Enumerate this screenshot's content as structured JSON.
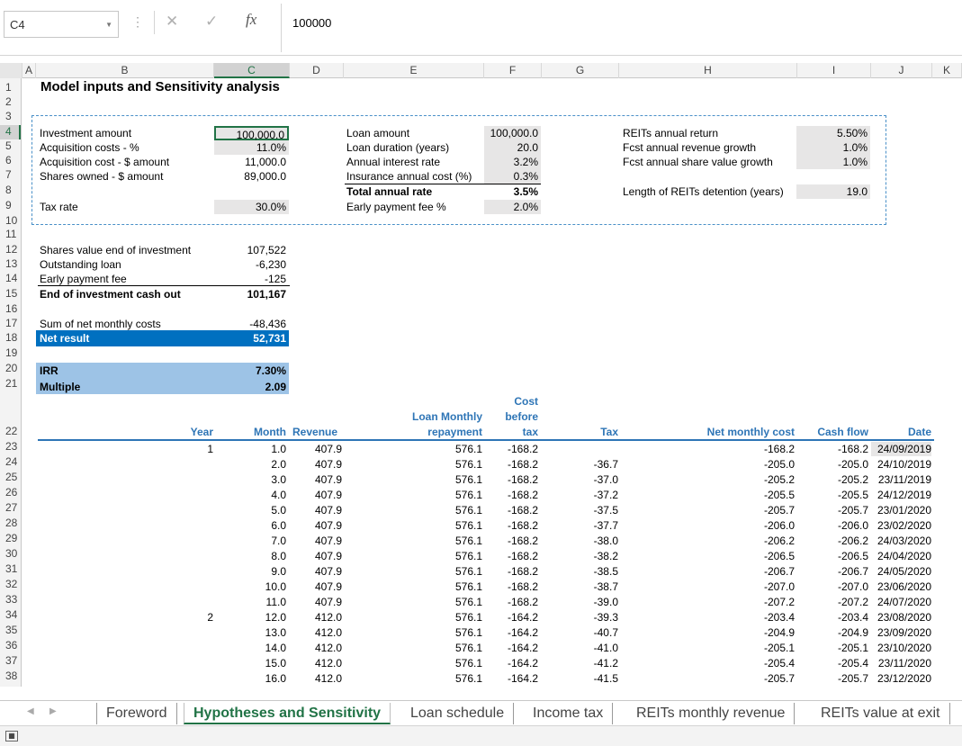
{
  "formula_bar": {
    "name_box": "C4",
    "formula": "100000",
    "fx": "fx"
  },
  "columns": [
    "A",
    "B",
    "C",
    "D",
    "E",
    "F",
    "G",
    "H",
    "I",
    "J",
    "K"
  ],
  "rows": [
    "1",
    "2",
    "3",
    "4",
    "5",
    "6",
    "7",
    "8",
    "9",
    "10",
    "11",
    "12",
    "13",
    "14",
    "15",
    "16",
    "17",
    "18",
    "19",
    "20",
    "21",
    "22",
    "23",
    "24",
    "25",
    "26",
    "27",
    "28",
    "29",
    "30",
    "31",
    "32",
    "33",
    "34",
    "35",
    "36",
    "37",
    "38"
  ],
  "title": "Model inputs and Sensitivity analysis",
  "inputs_left": [
    {
      "label": "Investment amount",
      "value": "100,000.0"
    },
    {
      "label": "Acquisition costs - %",
      "value": "11.0%"
    },
    {
      "label": "Acquisition cost - $ amount",
      "value": "11,000.0"
    },
    {
      "label": "Shares owned - $ amount",
      "value": "89,000.0"
    }
  ],
  "tax_rate": {
    "label": "Tax rate",
    "value": "30.0%"
  },
  "inputs_mid": [
    {
      "label": "Loan amount",
      "value": "100,000.0"
    },
    {
      "label": "Loan duration (years)",
      "value": "20.0"
    },
    {
      "label": "Annual interest rate",
      "value": "3.2%"
    },
    {
      "label": "Insurance annual cost (%)",
      "value": "0.3%"
    },
    {
      "label": "Total annual rate",
      "value": "3.5%"
    },
    {
      "label": "Early payment fee %",
      "value": "2.0%"
    }
  ],
  "inputs_right": [
    {
      "label": "REITs annual return",
      "value": "5.50%"
    },
    {
      "label": "Fcst annual revenue growth",
      "value": "1.0%"
    },
    {
      "label": "Fcst annual share value growth",
      "value": "1.0%"
    }
  ],
  "detention": {
    "label": "Length of REITs detention (years)",
    "value": "19.0"
  },
  "summary": [
    {
      "label": "Shares value end of investment",
      "value": "107,522"
    },
    {
      "label": "Outstanding loan",
      "value": "-6,230"
    },
    {
      "label": "Early payment fee",
      "value": "-125"
    },
    {
      "label": "End of investment cash out",
      "value": "101,167"
    }
  ],
  "net": {
    "sum_label": "Sum of net monthly costs",
    "sum_value": "-48,436",
    "result_label": "Net result",
    "result_value": "52,731"
  },
  "irr": {
    "irr_label": "IRR",
    "irr_value": "7.30%",
    "mult_label": "Multiple",
    "mult_value": "2.09"
  },
  "table_headers": {
    "year": "Year",
    "month": "Month",
    "revenue": "Revenue",
    "loan1": "Loan Monthly",
    "loan2": "repayment",
    "cost1": "Cost",
    "cost2": "before",
    "cost3": "tax",
    "tax": "Tax",
    "net": "Net monthly cost",
    "cash": "Cash flow",
    "date": "Date"
  },
  "table_rows": [
    {
      "year": "1",
      "month": "1.0",
      "rev": "407.9",
      "loan": "576.1",
      "cost": "-168.2",
      "tax": "",
      "net": "-168.2",
      "cash": "-168.2",
      "date": "24/09/2019"
    },
    {
      "year": "",
      "month": "2.0",
      "rev": "407.9",
      "loan": "576.1",
      "cost": "-168.2",
      "tax": "-36.7",
      "net": "-205.0",
      "cash": "-205.0",
      "date": "24/10/2019"
    },
    {
      "year": "",
      "month": "3.0",
      "rev": "407.9",
      "loan": "576.1",
      "cost": "-168.2",
      "tax": "-37.0",
      "net": "-205.2",
      "cash": "-205.2",
      "date": "23/11/2019"
    },
    {
      "year": "",
      "month": "4.0",
      "rev": "407.9",
      "loan": "576.1",
      "cost": "-168.2",
      "tax": "-37.2",
      "net": "-205.5",
      "cash": "-205.5",
      "date": "24/12/2019"
    },
    {
      "year": "",
      "month": "5.0",
      "rev": "407.9",
      "loan": "576.1",
      "cost": "-168.2",
      "tax": "-37.5",
      "net": "-205.7",
      "cash": "-205.7",
      "date": "23/01/2020"
    },
    {
      "year": "",
      "month": "6.0",
      "rev": "407.9",
      "loan": "576.1",
      "cost": "-168.2",
      "tax": "-37.7",
      "net": "-206.0",
      "cash": "-206.0",
      "date": "23/02/2020"
    },
    {
      "year": "",
      "month": "7.0",
      "rev": "407.9",
      "loan": "576.1",
      "cost": "-168.2",
      "tax": "-38.0",
      "net": "-206.2",
      "cash": "-206.2",
      "date": "24/03/2020"
    },
    {
      "year": "",
      "month": "8.0",
      "rev": "407.9",
      "loan": "576.1",
      "cost": "-168.2",
      "tax": "-38.2",
      "net": "-206.5",
      "cash": "-206.5",
      "date": "24/04/2020"
    },
    {
      "year": "",
      "month": "9.0",
      "rev": "407.9",
      "loan": "576.1",
      "cost": "-168.2",
      "tax": "-38.5",
      "net": "-206.7",
      "cash": "-206.7",
      "date": "24/05/2020"
    },
    {
      "year": "",
      "month": "10.0",
      "rev": "407.9",
      "loan": "576.1",
      "cost": "-168.2",
      "tax": "-38.7",
      "net": "-207.0",
      "cash": "-207.0",
      "date": "23/06/2020"
    },
    {
      "year": "",
      "month": "11.0",
      "rev": "407.9",
      "loan": "576.1",
      "cost": "-168.2",
      "tax": "-39.0",
      "net": "-207.2",
      "cash": "-207.2",
      "date": "24/07/2020"
    },
    {
      "year": "2",
      "month": "12.0",
      "rev": "412.0",
      "loan": "576.1",
      "cost": "-164.2",
      "tax": "-39.3",
      "net": "-203.4",
      "cash": "-203.4",
      "date": "23/08/2020"
    },
    {
      "year": "",
      "month": "13.0",
      "rev": "412.0",
      "loan": "576.1",
      "cost": "-164.2",
      "tax": "-40.7",
      "net": "-204.9",
      "cash": "-204.9",
      "date": "23/09/2020"
    },
    {
      "year": "",
      "month": "14.0",
      "rev": "412.0",
      "loan": "576.1",
      "cost": "-164.2",
      "tax": "-41.0",
      "net": "-205.1",
      "cash": "-205.1",
      "date": "23/10/2020"
    },
    {
      "year": "",
      "month": "15.0",
      "rev": "412.0",
      "loan": "576.1",
      "cost": "-164.2",
      "tax": "-41.2",
      "net": "-205.4",
      "cash": "-205.4",
      "date": "23/11/2020"
    },
    {
      "year": "",
      "month": "16.0",
      "rev": "412.0",
      "loan": "576.1",
      "cost": "-164.2",
      "tax": "-41.5",
      "net": "-205.7",
      "cash": "-205.7",
      "date": "23/12/2020"
    }
  ],
  "sheet_tabs": [
    "Foreword",
    "Hypotheses and Sensitivity",
    "Loan schedule",
    "Income tax",
    "REITs monthly revenue",
    "REITs value at exit"
  ],
  "colors": {
    "excel_green": "#217346",
    "net_result_bg": "#0070c0",
    "irr_bg": "#9dc3e6",
    "input_bg": "#e7e6e6",
    "header_line": "#2e75b6"
  }
}
